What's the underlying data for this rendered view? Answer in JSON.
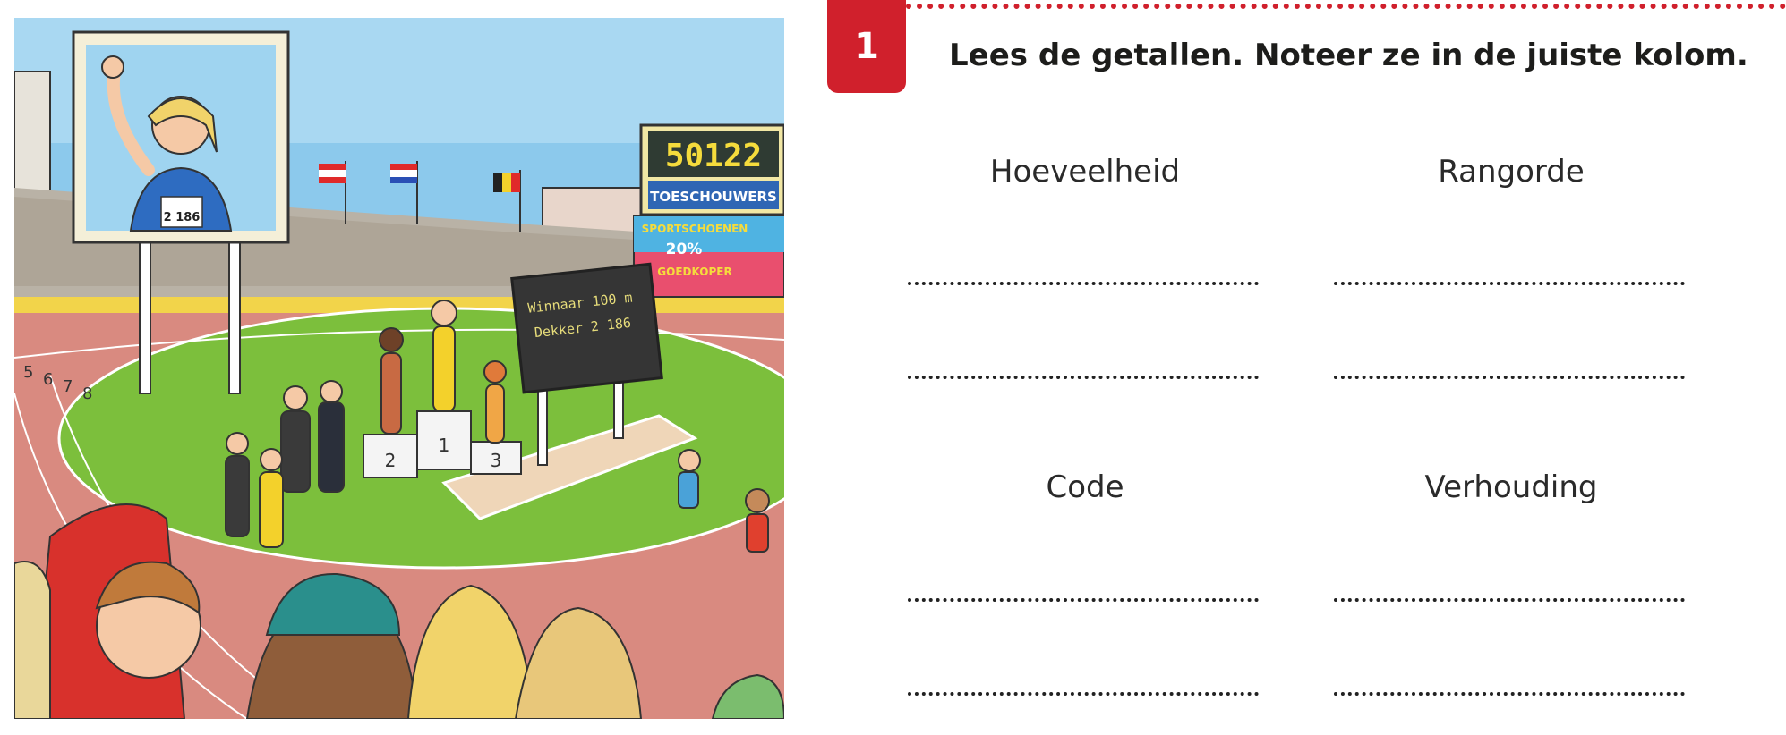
{
  "exercise": {
    "number": "1",
    "instruction": "Lees de getallen. Noteer ze in de juiste kolom."
  },
  "columns": [
    {
      "label": "Hoeveelheid"
    },
    {
      "label": "Rangorde"
    },
    {
      "label": "Code"
    },
    {
      "label": "Verhouding"
    }
  ],
  "illustration": {
    "scoreboard_number": "50122",
    "scoreboard_label": "TOESCHOUWERS",
    "ad_line1": "SPORTSCHOENEN",
    "ad_line2": "20%",
    "ad_line3": "GOEDKOPER",
    "result_board_line1": "Winnaar 100 m",
    "result_board_line2": "Dekker 2 186",
    "bib_number": "2 186",
    "podium_1": "1",
    "podium_2": "2",
    "podium_3": "3",
    "lane_numbers": [
      "5",
      "6",
      "7",
      "8"
    ]
  },
  "colors": {
    "accent_red": "#d0202c",
    "track": "#d98a80",
    "grass": "#7cbf3c",
    "sky": "#8cc9ec"
  }
}
